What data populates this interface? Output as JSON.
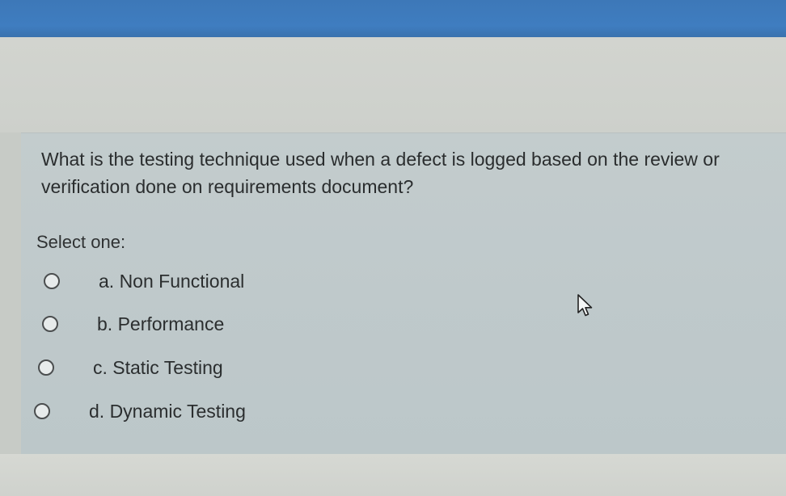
{
  "question": {
    "text": "What is the testing technique used when a defect is logged based on the review or verification done on requirements document?",
    "prompt": "Select one:"
  },
  "options": [
    {
      "label": "a. Non Functional",
      "selected": false
    },
    {
      "label": "b. Performance",
      "selected": false
    },
    {
      "label": "c. Static Testing",
      "selected": false
    },
    {
      "label": "d. Dynamic Testing",
      "selected": false
    }
  ],
  "icons": {
    "cursor": "mouse-pointer-icon",
    "radio": "radio-button-icon"
  },
  "colors": {
    "top_bar": "#3f7dc0",
    "question_background": "#bfc9cb",
    "page_background": "#d3d6d2",
    "text": "#2a2d2e"
  }
}
